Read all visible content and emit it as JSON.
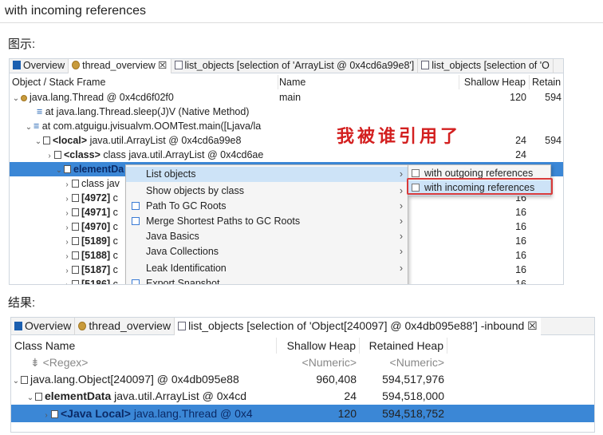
{
  "heading": "with incoming references",
  "caption_diagram": "图示:",
  "caption_result": "结果:",
  "annotation": "我被谁引用了",
  "top": {
    "tabs": [
      "Overview",
      "thread_overview ☒",
      "list_objects  [selection of 'ArrayList @ 0x4cd6a99e8']",
      "list_objects  [selection of 'O"
    ],
    "columns": [
      "Object / Stack Frame",
      "Name",
      "Shallow Heap",
      "Retain"
    ],
    "rows": [
      {
        "text": "java.lang.Thread @ 0x4cd6f02f0",
        "name": "main",
        "shallow": "120",
        "retained": "594"
      },
      {
        "text": "at java.lang.Thread.sleep(J)V (Native Method)",
        "name": "",
        "shallow": "",
        "retained": ""
      },
      {
        "text": "at com.atguigu.jvisualvm.OOMTest.main([Ljava/la",
        "name": "",
        "shallow": "",
        "retained": ""
      },
      {
        "tag": "<local>",
        "text": " java.util.ArrayList @ 0x4cd6a99e8",
        "name": "",
        "shallow": "24",
        "retained": "594"
      },
      {
        "tag": "<class>",
        "text": " class java.util.ArrayList @ 0x4cd6ae",
        "name": "",
        "shallow": "24",
        "retained": ""
      },
      {
        "tag": "elementDa",
        "text": "",
        "name": "",
        "shallow": "",
        "retained": ""
      },
      {
        "text": "class jav",
        "name": "",
        "shallow": "",
        "retained": ""
      },
      {
        "tag": "[4972]",
        "text": " c",
        "name": "",
        "shallow": "16",
        "retained": ""
      },
      {
        "tag": "[4971]",
        "text": " c",
        "name": "",
        "shallow": "16",
        "retained": ""
      },
      {
        "tag": "[4970]",
        "text": " c",
        "name": "",
        "shallow": "16",
        "retained": ""
      },
      {
        "tag": "[5189]",
        "text": " c",
        "name": "",
        "shallow": "16",
        "retained": ""
      },
      {
        "tag": "[5188]",
        "text": " c",
        "name": "",
        "shallow": "16",
        "retained": ""
      },
      {
        "tag": "[5187]",
        "text": " c",
        "name": "",
        "shallow": "16",
        "retained": ""
      },
      {
        "tag": "[5186]",
        "text": " c",
        "name": "",
        "shallow": "16",
        "retained": ""
      }
    ],
    "menu": [
      "List objects",
      "Show objects by class",
      "Path To GC Roots",
      "Merge Shortest Paths to GC Roots",
      "Java Basics",
      "Java Collections",
      "Leak Identification",
      "Export Snapshot"
    ],
    "submenu": [
      "with outgoing references",
      "with incoming references"
    ]
  },
  "bottom": {
    "tabs": [
      "Overview",
      "thread_overview",
      "list_objects  [selection of 'Object[240097] @ 0x4db095e88'] -inbound ☒"
    ],
    "columns": [
      "Class Name",
      "Shallow Heap",
      "Retained Heap"
    ],
    "filters": [
      "<Regex>",
      "<Numeric>",
      "<Numeric>"
    ],
    "rows": [
      {
        "tag": "",
        "text": "java.lang.Object[240097] @ 0x4db095e88",
        "shallow": "960,408",
        "retained": "594,517,976"
      },
      {
        "tag": "elementData",
        "text": " java.util.ArrayList @ 0x4cd",
        "shallow": "24",
        "retained": "594,518,000"
      },
      {
        "tag": "<Java Local>",
        "text": " java.lang.Thread @ 0x4",
        "shallow": "120",
        "retained": "594,518,752"
      }
    ]
  }
}
